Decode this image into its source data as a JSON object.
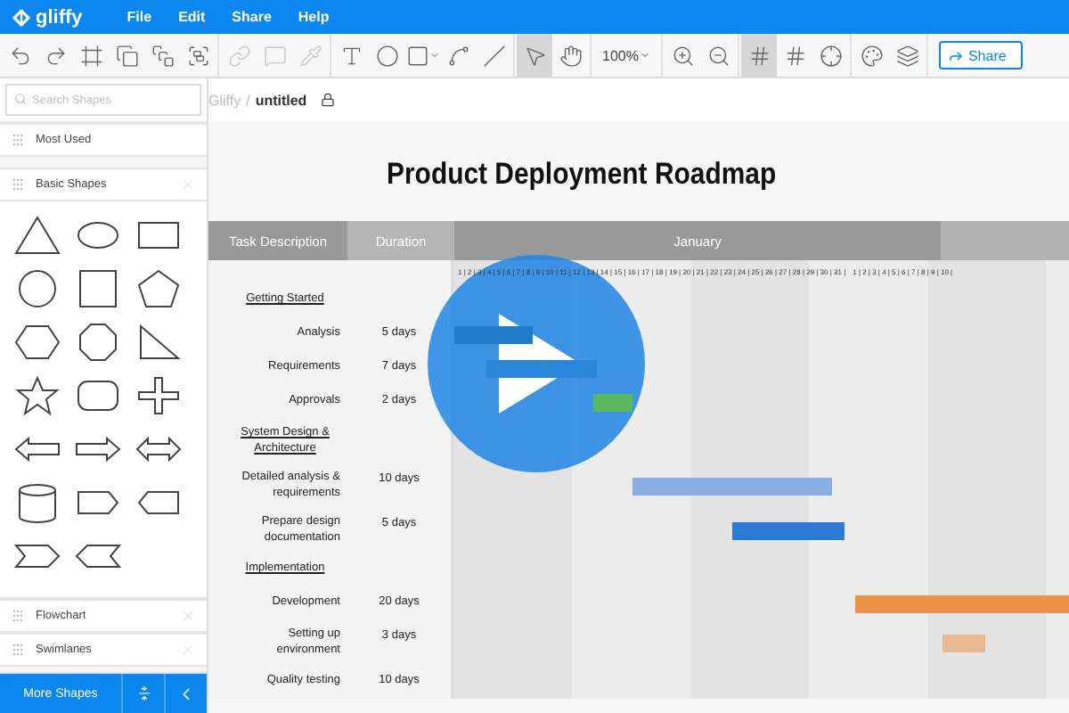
{
  "app": {
    "logo": "gliffy",
    "menu": [
      {
        "label": "File"
      },
      {
        "label": "Edit"
      },
      {
        "label": "Share"
      },
      {
        "label": "Help"
      }
    ]
  },
  "toolbar": {
    "groups": [
      [
        {
          "kind": "undo",
          "disabled": false,
          "selected": false
        },
        {
          "kind": "redo",
          "disabled": false,
          "selected": false
        },
        {
          "kind": "frame",
          "disabled": false,
          "selected": false
        },
        {
          "kind": "bring-front",
          "disabled": false,
          "selected": false
        },
        {
          "kind": "send-back",
          "disabled": false,
          "selected": false
        },
        {
          "kind": "group",
          "disabled": false,
          "selected": false
        }
      ],
      [
        {
          "kind": "link",
          "disabled": true,
          "selected": false
        },
        {
          "kind": "comment",
          "disabled": true,
          "selected": false
        },
        {
          "kind": "pipette",
          "disabled": true,
          "selected": false
        }
      ],
      [
        {
          "kind": "text",
          "disabled": false,
          "selected": false
        },
        {
          "kind": "ellipse",
          "disabled": false,
          "selected": false
        },
        {
          "kind": "rectangle",
          "disabled": false,
          "selected": false
        },
        {
          "kind": "connector",
          "disabled": false,
          "selected": false
        },
        {
          "kind": "line",
          "disabled": false,
          "selected": false
        }
      ],
      [
        {
          "kind": "pointer",
          "disabled": false,
          "selected": true
        },
        {
          "kind": "hand",
          "disabled": false,
          "selected": false
        }
      ]
    ],
    "zoom": "100%",
    "view_groups": [
      [
        {
          "kind": "zoom-in",
          "disabled": false,
          "selected": false
        },
        {
          "kind": "zoom-out",
          "disabled": false,
          "selected": false
        }
      ],
      [
        {
          "kind": "grid",
          "disabled": false,
          "selected": true
        },
        {
          "kind": "grid",
          "disabled": false,
          "selected": false
        },
        {
          "kind": "crosshair",
          "disabled": false,
          "selected": false
        }
      ],
      [
        {
          "kind": "palette",
          "disabled": false,
          "selected": false
        },
        {
          "kind": "layers",
          "disabled": false,
          "selected": false
        }
      ]
    ],
    "share": "Share"
  },
  "sidebar": {
    "search": {
      "placeholder": "Search Shapes"
    },
    "sections": [
      {
        "label": "Most Used",
        "closable": false,
        "expanded": false
      },
      {
        "label": "Basic Shapes",
        "closable": true,
        "expanded": true
      },
      {
        "label": "Flowchart",
        "closable": true,
        "expanded": false
      },
      {
        "label": "Swimlanes",
        "closable": true,
        "expanded": false
      }
    ],
    "shapes": [
      {
        "kind": "triangle"
      },
      {
        "kind": "ellipse"
      },
      {
        "kind": "rectangle"
      },
      {
        "kind": "circle"
      },
      {
        "kind": "square"
      },
      {
        "kind": "pentagon"
      },
      {
        "kind": "hexagon"
      },
      {
        "kind": "octagon"
      },
      {
        "kind": "right-triangle"
      },
      {
        "kind": "star"
      },
      {
        "kind": "rounded-rectangle"
      },
      {
        "kind": "cross"
      },
      {
        "kind": "arrow-left"
      },
      {
        "kind": "arrow-right"
      },
      {
        "kind": "arrow-double"
      },
      {
        "kind": "cylinder"
      },
      {
        "kind": "tag-right"
      },
      {
        "kind": "tag-left"
      },
      {
        "kind": "chevron-right"
      },
      {
        "kind": "chevron-left"
      }
    ],
    "more_shapes": "More Shapes"
  },
  "document": {
    "root": "Gliffy",
    "separator": "/",
    "name": "untitled"
  },
  "diagram": {
    "title": "Product Deployment Roadmap",
    "columns": [
      "Task Description",
      "Duration"
    ],
    "month": "January",
    "days": [
      "1 | 2 | 3 | 4 | 5 | 6 | 7 | 8 | 9 | 10 | 11 | 12 | 13 | 14 | 15 | 16 | 17 | 18 | 19 | 20 | 21 | 22 | 23 | 24 | 25 | 26 | 27 | 28 | 29 | 30 | 31 |",
      "1 | 2 | 3 | 4 | 5 | 6 | 7 | 8 | 9 | 10 |"
    ],
    "rows": [
      {
        "kind": "section",
        "task": "Getting Started"
      },
      {
        "kind": "task",
        "task": "Analysis",
        "duration": "5 days",
        "color": "#1f7cc9"
      },
      {
        "kind": "task",
        "task": "Requirements",
        "duration": "7 days",
        "color": "#2a86d8"
      },
      {
        "kind": "task",
        "task": "Approvals",
        "duration": "2 days",
        "color": "#5cb85c"
      },
      {
        "kind": "section",
        "task": "System Design & Architecture"
      },
      {
        "kind": "task",
        "task": "Detailed analysis & requirements",
        "duration": "10 days",
        "color": "#89aee2"
      },
      {
        "kind": "task",
        "task": "Prepare design documentation",
        "duration": "5 days",
        "color": "#2b7ad6"
      },
      {
        "kind": "section",
        "task": "Implementation"
      },
      {
        "kind": "task",
        "task": "Development",
        "duration": "20 days",
        "color": "#ef9446"
      },
      {
        "kind": "task",
        "task": "Setting up environment",
        "duration": "3 days",
        "color": "#e8b993"
      },
      {
        "kind": "task",
        "task": "Quality testing",
        "duration": "10 days"
      }
    ]
  }
}
